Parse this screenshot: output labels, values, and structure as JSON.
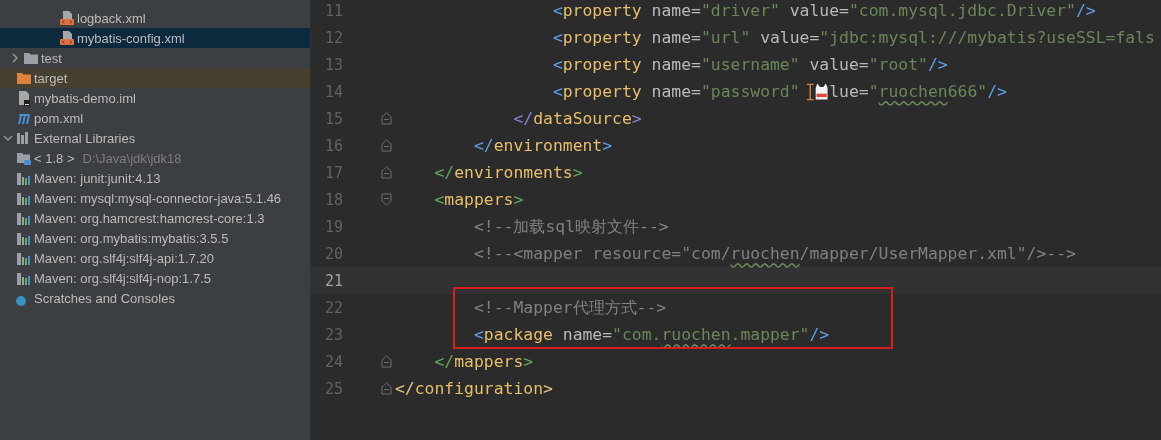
{
  "project_tree": [
    {
      "children": [
        {
          "children": [
            {
              "children": [
                {
                  "children": [
                    {
                      "label": "logback.xml",
                      "kind": "xml",
                      "selected": false
                    },
                    {
                      "label": "mybatis-config.xml",
                      "kind": "xml",
                      "selected": true
                    }
                  ]
                }
              ]
            },
            {
              "label": "test",
              "kind": "folder",
              "expanded": false,
              "selected": false
            }
          ]
        },
        {
          "label": "target",
          "kind": "excluded-folder",
          "selected": false
        },
        {
          "label": "mybatis-demo.iml",
          "kind": "iml",
          "selected": false
        },
        {
          "label": "pom.xml",
          "kind": "pom",
          "selected": false
        }
      ]
    },
    {
      "label": "External Libraries",
      "kind": "libraries",
      "expanded": true,
      "selected": false,
      "children": [
        {
          "label": "< 1.8 >",
          "path": "D:\\Java\\jdk\\jdk18",
          "kind": "jdk",
          "selected": false
        },
        {
          "label": "Maven: junit:junit:4.13",
          "kind": "maven",
          "selected": false
        },
        {
          "label": "Maven: mysql:mysql-connector-java:5.1.46",
          "kind": "maven",
          "selected": false
        },
        {
          "label": "Maven: org.hamcrest:hamcrest-core:1.3",
          "kind": "maven",
          "selected": false
        },
        {
          "label": "Maven: org.mybatis:mybatis:3.5.5",
          "kind": "maven",
          "selected": false
        },
        {
          "label": "Maven: org.slf4j:slf4j-api:1.7.20",
          "kind": "maven",
          "selected": false
        },
        {
          "label": "Maven: org.slf4j:slf4j-nop:1.7.5",
          "kind": "maven",
          "selected": false
        }
      ]
    },
    {
      "label": "Scratches and Consoles",
      "kind": "scratches",
      "selected": false
    }
  ],
  "editor": {
    "lines": [
      {
        "children": [
          {
            "children": [
              {
                "children": [
                  {
                    "children": [
                      {
                        "num": "11",
                        "selected": false,
                        "tokens": [
                          {
                            "kind": "bracket",
                            "text": "<",
                            "color": "#5c9ee8"
                          },
                          {
                            "kind": "tag",
                            "text": "property"
                          },
                          {
                            "kind": "attr",
                            "text": " name="
                          },
                          {
                            "kind": "str",
                            "text": "\"driver\""
                          },
                          {
                            "kind": "attr",
                            "text": " value="
                          },
                          {
                            "kind": "str",
                            "text": "\"com.mysql.jdbc.Driver\""
                          },
                          {
                            "kind": "bracket",
                            "text": "/>",
                            "color": "#5c9ee8"
                          }
                        ]
                      },
                      {
                        "num": "12",
                        "selected": false,
                        "tokens": [
                          {
                            "kind": "bracket",
                            "text": "<",
                            "color": "#5c9ee8"
                          },
                          {
                            "kind": "tag",
                            "text": "property"
                          },
                          {
                            "kind": "attr",
                            "text": " name="
                          },
                          {
                            "kind": "str",
                            "text": "\"url\""
                          },
                          {
                            "kind": "attr",
                            "text": " value="
                          },
                          {
                            "kind": "str",
                            "text": "\"jdbc:mysql:///mybatis?useSSL=fals"
                          }
                        ]
                      },
                      {
                        "num": "13",
                        "selected": false,
                        "tokens": [
                          {
                            "kind": "bracket",
                            "text": "<",
                            "color": "#5c9ee8"
                          },
                          {
                            "kind": "tag",
                            "text": "property"
                          },
                          {
                            "kind": "attr",
                            "text": " name="
                          },
                          {
                            "kind": "str",
                            "text": "\"username\""
                          },
                          {
                            "kind": "attr",
                            "text": " value="
                          },
                          {
                            "kind": "str",
                            "text": "\"root\""
                          },
                          {
                            "kind": "bracket",
                            "text": "/>",
                            "color": "#5c9ee8"
                          }
                        ]
                      },
                      {
                        "num": "14",
                        "selected": false,
                        "tokens": [
                          {
                            "kind": "bracket",
                            "text": "<",
                            "color": "#5c9ee8"
                          },
                          {
                            "kind": "tag",
                            "text": "property"
                          },
                          {
                            "kind": "attr",
                            "text": " name="
                          },
                          {
                            "kind": "str",
                            "text": "\"password\""
                          },
                          {
                            "kind": "cursor-sticker"
                          },
                          {
                            "kind": "attr",
                            "text": "lue="
                          },
                          {
                            "kind": "str",
                            "text": "\""
                          },
                          {
                            "kind": "str-typo",
                            "text": "ruochen"
                          },
                          {
                            "kind": "str",
                            "text": "666\""
                          },
                          {
                            "kind": "bracket",
                            "text": "/>",
                            "color": "#5c9ee8"
                          }
                        ]
                      }
                    ]
                  },
                  {
                    "num": "15",
                    "selected": false,
                    "fold_end": true,
                    "tokens": [
                      {
                        "kind": "bracket",
                        "text": "</",
                        "color": "#8d7fd6"
                      },
                      {
                        "kind": "tag",
                        "text": "dataSource"
                      },
                      {
                        "kind": "bracket",
                        "text": ">",
                        "color": "#8d7fd6"
                      }
                    ]
                  }
                ]
              },
              {
                "num": "16",
                "selected": false,
                "fold_end": true,
                "tokens": [
                  {
                    "kind": "bracket",
                    "text": "</",
                    "color": "#5c9ee8"
                  },
                  {
                    "kind": "tag",
                    "text": "environment"
                  },
                  {
                    "kind": "bracket",
                    "text": ">",
                    "color": "#5c9ee8"
                  }
                ]
              }
            ]
          },
          {
            "num": "17",
            "selected": false,
            "fold_end": true,
            "tokens": [
              {
                "kind": "bracket",
                "text": "</",
                "color": "#5fa75a"
              },
              {
                "kind": "tag",
                "text": "environments"
              },
              {
                "kind": "bracket",
                "text": ">",
                "color": "#5fa75a"
              }
            ]
          },
          {
            "num": "18",
            "selected": false,
            "fold_start": true,
            "tokens": [
              {
                "kind": "bracket",
                "text": "<",
                "color": "#5fa75a"
              },
              {
                "kind": "tag",
                "text": "mappers"
              },
              {
                "kind": "bracket",
                "text": ">",
                "color": "#5fa75a"
              }
            ],
            "children": [
              {
                "num": "19",
                "selected": false,
                "tokens": [
                  {
                    "kind": "comment",
                    "text": "<!--加载sql映射文件-->"
                  }
                ]
              },
              {
                "num": "20",
                "selected": false,
                "tokens": [
                  {
                    "kind": "comment",
                    "text": "<!--<mapper resource=\"com/"
                  },
                  {
                    "kind": "comment-typo",
                    "text": "ruochen"
                  },
                  {
                    "kind": "comment",
                    "text": "/mapper/UserMapper.xml\"/>-->"
                  }
                ]
              },
              {
                "num": "21",
                "selected": true
              },
              {
                "num": "22",
                "selected": false,
                "tokens": [
                  {
                    "kind": "comment",
                    "text": "<!--Mapper代理方式-->"
                  }
                ]
              },
              {
                "num": "23",
                "selected": false,
                "tokens": [
                  {
                    "kind": "bracket",
                    "text": "<",
                    "color": "#5c9ee8"
                  },
                  {
                    "kind": "tag",
                    "text": "package"
                  },
                  {
                    "kind": "attr",
                    "text": " name="
                  },
                  {
                    "kind": "str",
                    "text": "\"com."
                  },
                  {
                    "kind": "str-typo",
                    "text": "ruochen"
                  },
                  {
                    "kind": "str",
                    "text": ".mapper\""
                  },
                  {
                    "kind": "bracket",
                    "text": "/>",
                    "color": "#5c9ee8"
                  }
                ]
              }
            ]
          },
          {
            "num": "24",
            "selected": false,
            "fold_end": true,
            "tokens": [
              {
                "kind": "bracket",
                "text": "</",
                "color": "#5fa75a"
              },
              {
                "kind": "tag",
                "text": "mappers"
              },
              {
                "kind": "bracket",
                "text": ">",
                "color": "#5fa75a"
              }
            ]
          }
        ]
      },
      {
        "num": "25",
        "selected": false,
        "fold_end": true,
        "tokens": [
          {
            "kind": "bracket",
            "text": "</",
            "color": "#e0c283"
          },
          {
            "kind": "tag",
            "text": "configuration"
          },
          {
            "kind": "bracket",
            "text": ">",
            "color": "#e0c283"
          }
        ]
      }
    ]
  }
}
